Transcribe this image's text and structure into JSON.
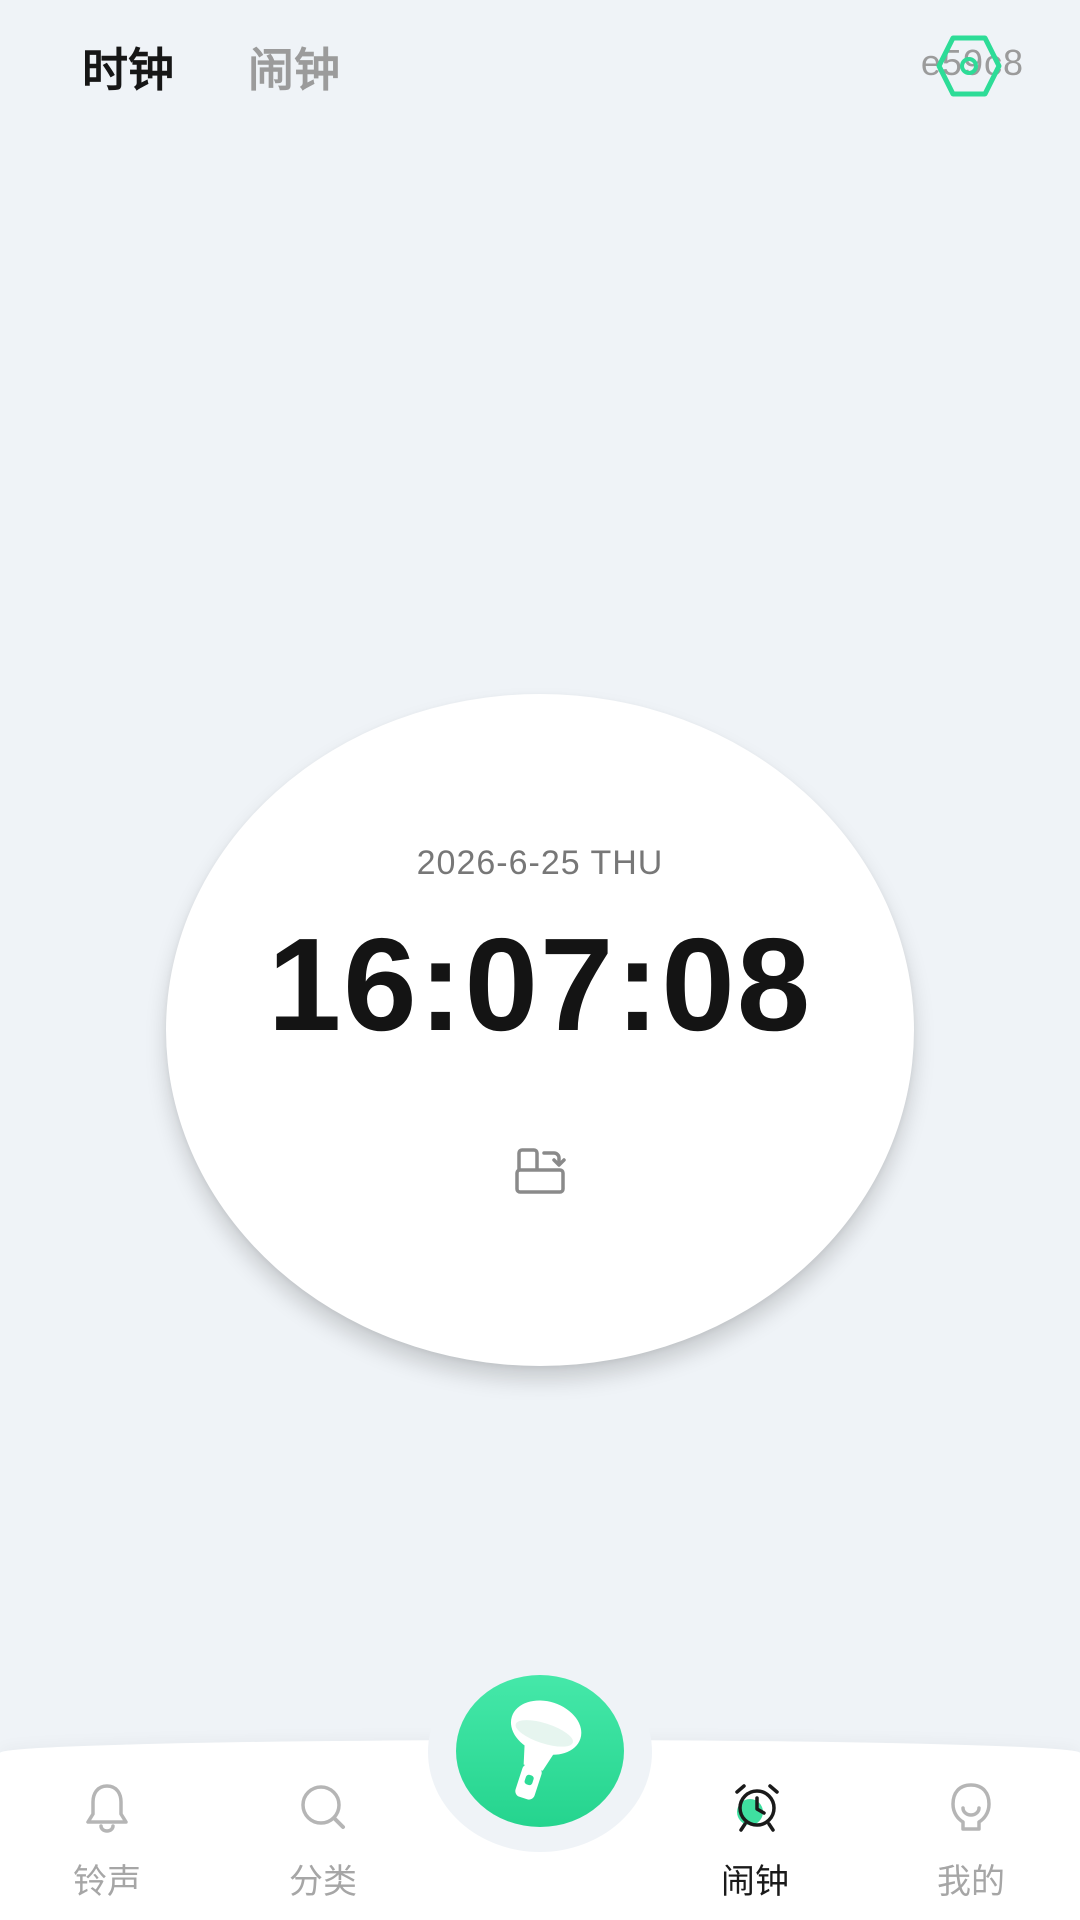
{
  "header": {
    "tabs": [
      {
        "label": "时钟",
        "active": true
      },
      {
        "label": "闹钟",
        "active": false
      }
    ],
    "corner_code": "e59c8",
    "corner_icon": "hexagon-badge-icon"
  },
  "clock": {
    "date": "2026-6-25 THU",
    "time": "16:07:08",
    "rotate_icon": "rotate-screen-icon"
  },
  "nav": {
    "items": [
      {
        "label": "铃声",
        "icon": "bell-icon",
        "active": false
      },
      {
        "label": "分类",
        "icon": "search-icon",
        "active": false
      },
      {
        "label": "闹钟",
        "icon": "alarm-clock-icon",
        "active": true
      },
      {
        "label": "我的",
        "icon": "profile-icon",
        "active": false
      }
    ],
    "center_icon": "flashlight-icon"
  },
  "colors": {
    "background": "#eff3f7",
    "accent_green": "#2ddc97",
    "text_primary": "#161616",
    "text_inactive": "#9b9b9b"
  }
}
